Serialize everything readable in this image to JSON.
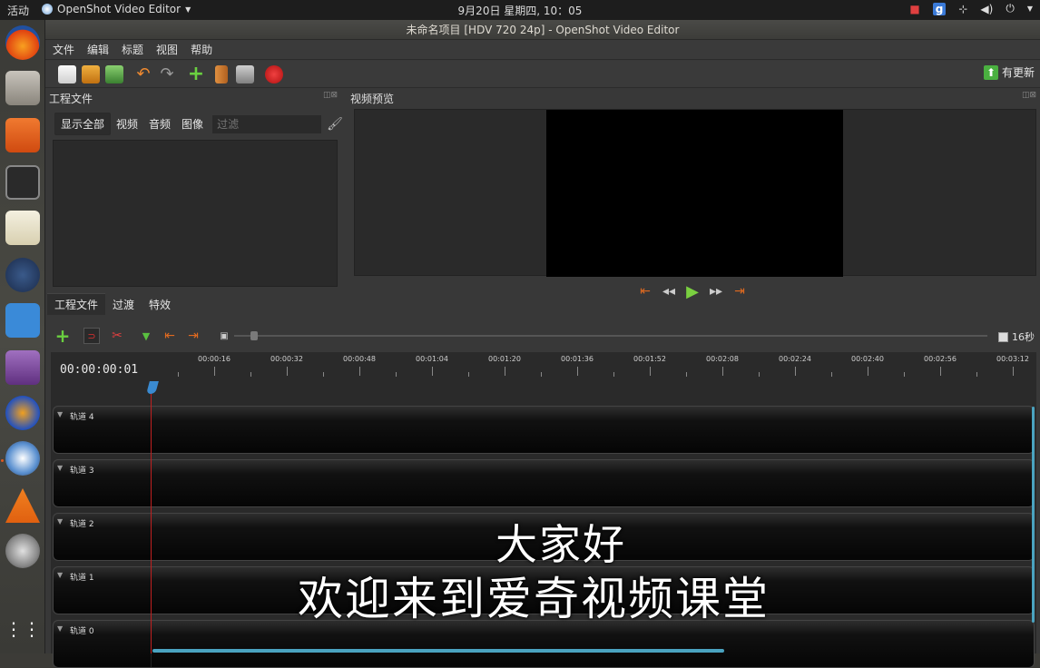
{
  "topbar": {
    "activities": "活动",
    "app_menu": "OpenShot Video Editor",
    "clock": "9月20日 星期四, 10：05"
  },
  "window": {
    "title": "未命名项目 [HDV 720 24p] - OpenShot Video Editor"
  },
  "menu": [
    "文件",
    "编辑",
    "标题",
    "视图",
    "帮助"
  ],
  "toolbar": {
    "update_label": "有更新"
  },
  "project_panel": {
    "title": "工程文件",
    "filters": [
      "显示全部",
      "视频",
      "音频",
      "图像"
    ],
    "filter_placeholder": "过滤"
  },
  "bottom_tabs": [
    "工程文件",
    "过渡",
    "特效"
  ],
  "preview_panel": {
    "title": "视频预览"
  },
  "timeline": {
    "time_code": "00:00:00:01",
    "zoom_label": "16秒",
    "ruler": [
      "00:00:16",
      "00:00:32",
      "00:00:48",
      "00:01:04",
      "00:01:20",
      "00:01:36",
      "00:01:52",
      "00:02:08",
      "00:02:24",
      "00:02:40",
      "00:02:56",
      "00:03:12"
    ],
    "tracks": [
      "轨道 4",
      "轨道 3",
      "轨道 2",
      "轨道 1",
      "轨道 0"
    ]
  },
  "subtitles": {
    "line1": "大家好",
    "line2": "欢迎来到爱奇视频课堂"
  },
  "colors": {
    "accent_orange": "#e06a20",
    "playhead": "#c02020",
    "scroll": "#4aa3c0"
  }
}
